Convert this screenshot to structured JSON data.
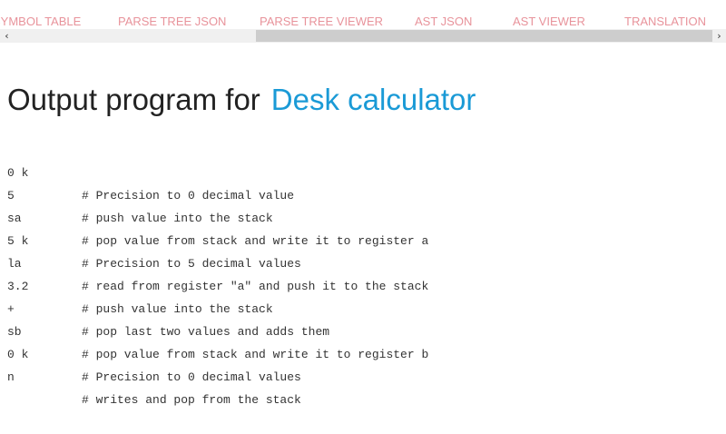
{
  "tabs": [
    {
      "label": "SYMBOL TABLE"
    },
    {
      "label": "PARSE TREE JSON"
    },
    {
      "label": "PARSE TREE VIEWER"
    },
    {
      "label": "AST JSON"
    },
    {
      "label": "AST VIEWER"
    },
    {
      "label": "TRANSLATION",
      "active": true
    }
  ],
  "scrollbar": {
    "left_arrow": "‹",
    "right_arrow": "›"
  },
  "heading": {
    "prefix": "Output program for",
    "language": "Desk calculator"
  },
  "program": [
    {
      "code": "0 k",
      "comment": "# Precision to 0 decimal value"
    },
    {
      "code": "5",
      "comment": "# push value into the stack"
    },
    {
      "code": "sa",
      "comment": "# pop value from stack and write it to register a"
    },
    {
      "code": "5 k",
      "comment": "# Precision to 5 decimal values"
    },
    {
      "code": "la",
      "comment": "# read from register \"a\" and push it to the stack"
    },
    {
      "code": "3.2",
      "comment": "# push value into the stack"
    },
    {
      "code": "+",
      "comment": "# pop last two values and adds them"
    },
    {
      "code": "sb",
      "comment": "# pop value from stack and write it to register b"
    },
    {
      "code": "0 k",
      "comment": "# Precision to 0 decimal values"
    },
    {
      "code": "n",
      "comment": "# writes and pop from the stack"
    }
  ],
  "colors": {
    "tab_text": "#e8939b",
    "accent": "#1a9ad6",
    "heading_text": "#222222",
    "code_text": "#333333"
  }
}
